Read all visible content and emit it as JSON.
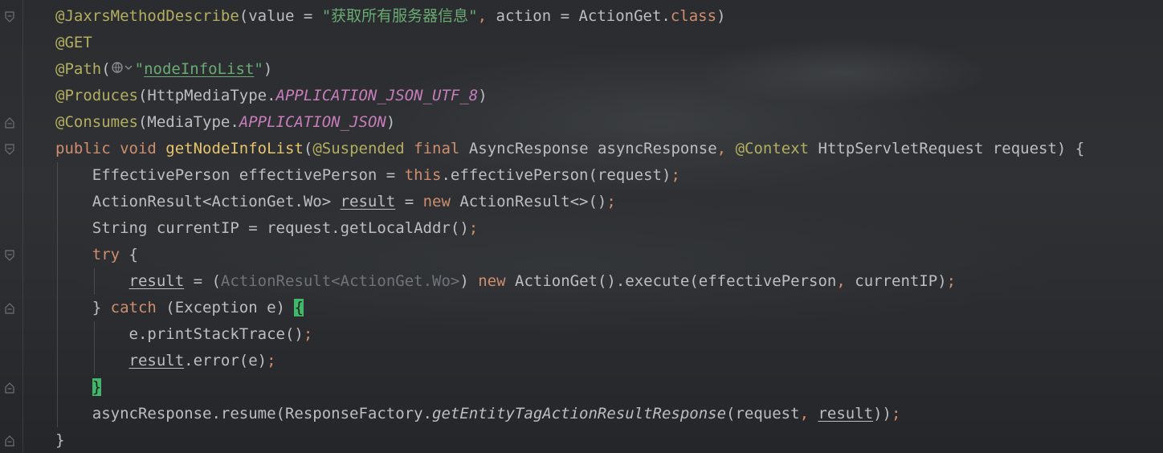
{
  "editor": {
    "lines": [
      {
        "segments": [
          {
            "t": "@JaxrsMethodDescribe",
            "c": "ann"
          },
          {
            "t": "(value = ",
            "c": ""
          },
          {
            "t": "\"获取所有服务器信息\"",
            "c": "str"
          },
          {
            "t": ", ",
            "c": "kw"
          },
          {
            "t": "action = ActionGet.",
            "c": ""
          },
          {
            "t": "class",
            "c": "kw"
          },
          {
            "t": ")",
            "c": ""
          }
        ]
      },
      {
        "segments": [
          {
            "t": "@GET",
            "c": "ann"
          }
        ]
      },
      {
        "segments": [
          {
            "t": "@Path",
            "c": "ann"
          },
          {
            "t": "(",
            "c": ""
          },
          {
            "t": "ICON",
            "c": "icon"
          },
          {
            "t": "\"",
            "c": "str"
          },
          {
            "t": "nodeInfoList",
            "c": "str und"
          },
          {
            "t": "\"",
            "c": "str"
          },
          {
            "t": ")",
            "c": ""
          }
        ]
      },
      {
        "segments": [
          {
            "t": "@Produces",
            "c": "ann"
          },
          {
            "t": "(HttpMediaType.",
            "c": ""
          },
          {
            "t": "APPLICATION_JSON_UTF_8",
            "c": "it"
          },
          {
            "t": ")",
            "c": ""
          }
        ]
      },
      {
        "segments": [
          {
            "t": "@Consumes",
            "c": "ann"
          },
          {
            "t": "(MediaType.",
            "c": ""
          },
          {
            "t": "APPLICATION_JSON",
            "c": "it"
          },
          {
            "t": ")",
            "c": ""
          }
        ]
      },
      {
        "segments": [
          {
            "t": "public void ",
            "c": "kw"
          },
          {
            "t": "getNodeInfoList",
            "c": "fn"
          },
          {
            "t": "(",
            "c": ""
          },
          {
            "t": "@Suspended ",
            "c": "ann"
          },
          {
            "t": "final ",
            "c": "kw"
          },
          {
            "t": "AsyncResponse asyncResponse",
            "c": ""
          },
          {
            "t": ", ",
            "c": "kw"
          },
          {
            "t": "@Context ",
            "c": "ann"
          },
          {
            "t": "HttpServletRequest request) {",
            "c": ""
          }
        ]
      },
      {
        "segments": [
          {
            "t": "    EffectivePerson effectivePerson = ",
            "c": ""
          },
          {
            "t": "this",
            "c": "kw"
          },
          {
            "t": ".effectivePerson(request)",
            "c": ""
          },
          {
            "t": ";",
            "c": "kw"
          }
        ]
      },
      {
        "segments": [
          {
            "t": "    ActionResult<ActionGet.Wo> ",
            "c": ""
          },
          {
            "t": "result",
            "c": "und"
          },
          {
            "t": " = ",
            "c": ""
          },
          {
            "t": "new ",
            "c": "kw"
          },
          {
            "t": "ActionResult<>()",
            "c": ""
          },
          {
            "t": ";",
            "c": "kw"
          }
        ]
      },
      {
        "segments": [
          {
            "t": "    String currentIP = request.getLocalAddr()",
            "c": ""
          },
          {
            "t": ";",
            "c": "kw"
          }
        ]
      },
      {
        "segments": [
          {
            "t": "    ",
            "c": ""
          },
          {
            "t": "try ",
            "c": "kw"
          },
          {
            "t": "{",
            "c": ""
          }
        ]
      },
      {
        "segments": [
          {
            "t": "        ",
            "c": ""
          },
          {
            "t": "result",
            "c": "und"
          },
          {
            "t": " = (",
            "c": ""
          },
          {
            "t": "ActionResult<ActionGet.Wo>",
            "c": "dim"
          },
          {
            "t": ") ",
            "c": ""
          },
          {
            "t": "new ",
            "c": "kw"
          },
          {
            "t": "ActionGet().execute(effectivePerson",
            "c": ""
          },
          {
            "t": ", ",
            "c": "kw"
          },
          {
            "t": "currentIP)",
            "c": ""
          },
          {
            "t": ";",
            "c": "kw"
          }
        ]
      },
      {
        "segments": [
          {
            "t": "    } ",
            "c": ""
          },
          {
            "t": "catch ",
            "c": "kw"
          },
          {
            "t": "(Exception e) ",
            "c": ""
          },
          {
            "t": "{",
            "c": "brace-hl"
          }
        ]
      },
      {
        "segments": [
          {
            "t": "        e.printStackTrace()",
            "c": ""
          },
          {
            "t": ";",
            "c": "kw"
          }
        ]
      },
      {
        "segments": [
          {
            "t": "        ",
            "c": ""
          },
          {
            "t": "result",
            "c": "und"
          },
          {
            "t": ".error(e)",
            "c": ""
          },
          {
            "t": ";",
            "c": "kw"
          }
        ]
      },
      {
        "segments": [
          {
            "t": "    ",
            "c": ""
          },
          {
            "t": "}",
            "c": "brace-hl"
          }
        ]
      },
      {
        "segments": [
          {
            "t": "    asyncResponse.resume(ResponseFactory.",
            "c": ""
          },
          {
            "t": "getEntityTagActionResultResponse",
            "c": "itfn"
          },
          {
            "t": "(request",
            "c": ""
          },
          {
            "t": ", ",
            "c": "kw"
          },
          {
            "t": "result",
            "c": "und"
          },
          {
            "t": "))",
            "c": ""
          },
          {
            "t": ";",
            "c": "kw"
          }
        ]
      },
      {
        "segments": [
          {
            "t": "}",
            "c": ""
          }
        ]
      }
    ],
    "path_icon": "globe-url-icon",
    "fold_markers": [
      {
        "line": 1,
        "kind": "fold-open-icon"
      },
      {
        "line": 5,
        "kind": "fold-close-icon"
      },
      {
        "line": 6,
        "kind": "fold-open-icon"
      },
      {
        "line": 10,
        "kind": "fold-open-icon"
      },
      {
        "line": 12,
        "kind": "fold-close-icon"
      },
      {
        "line": 15,
        "kind": "fold-close-icon"
      },
      {
        "line": 17,
        "kind": "fold-close-icon"
      }
    ],
    "colors": {
      "annotation": "#b3ae60",
      "keyword": "#cf8e6d",
      "method": "#e8c46d",
      "string": "#6aab73",
      "constant": "#c77dbb",
      "text": "#bcbec4",
      "brace_highlight": "#3fb86b"
    }
  }
}
